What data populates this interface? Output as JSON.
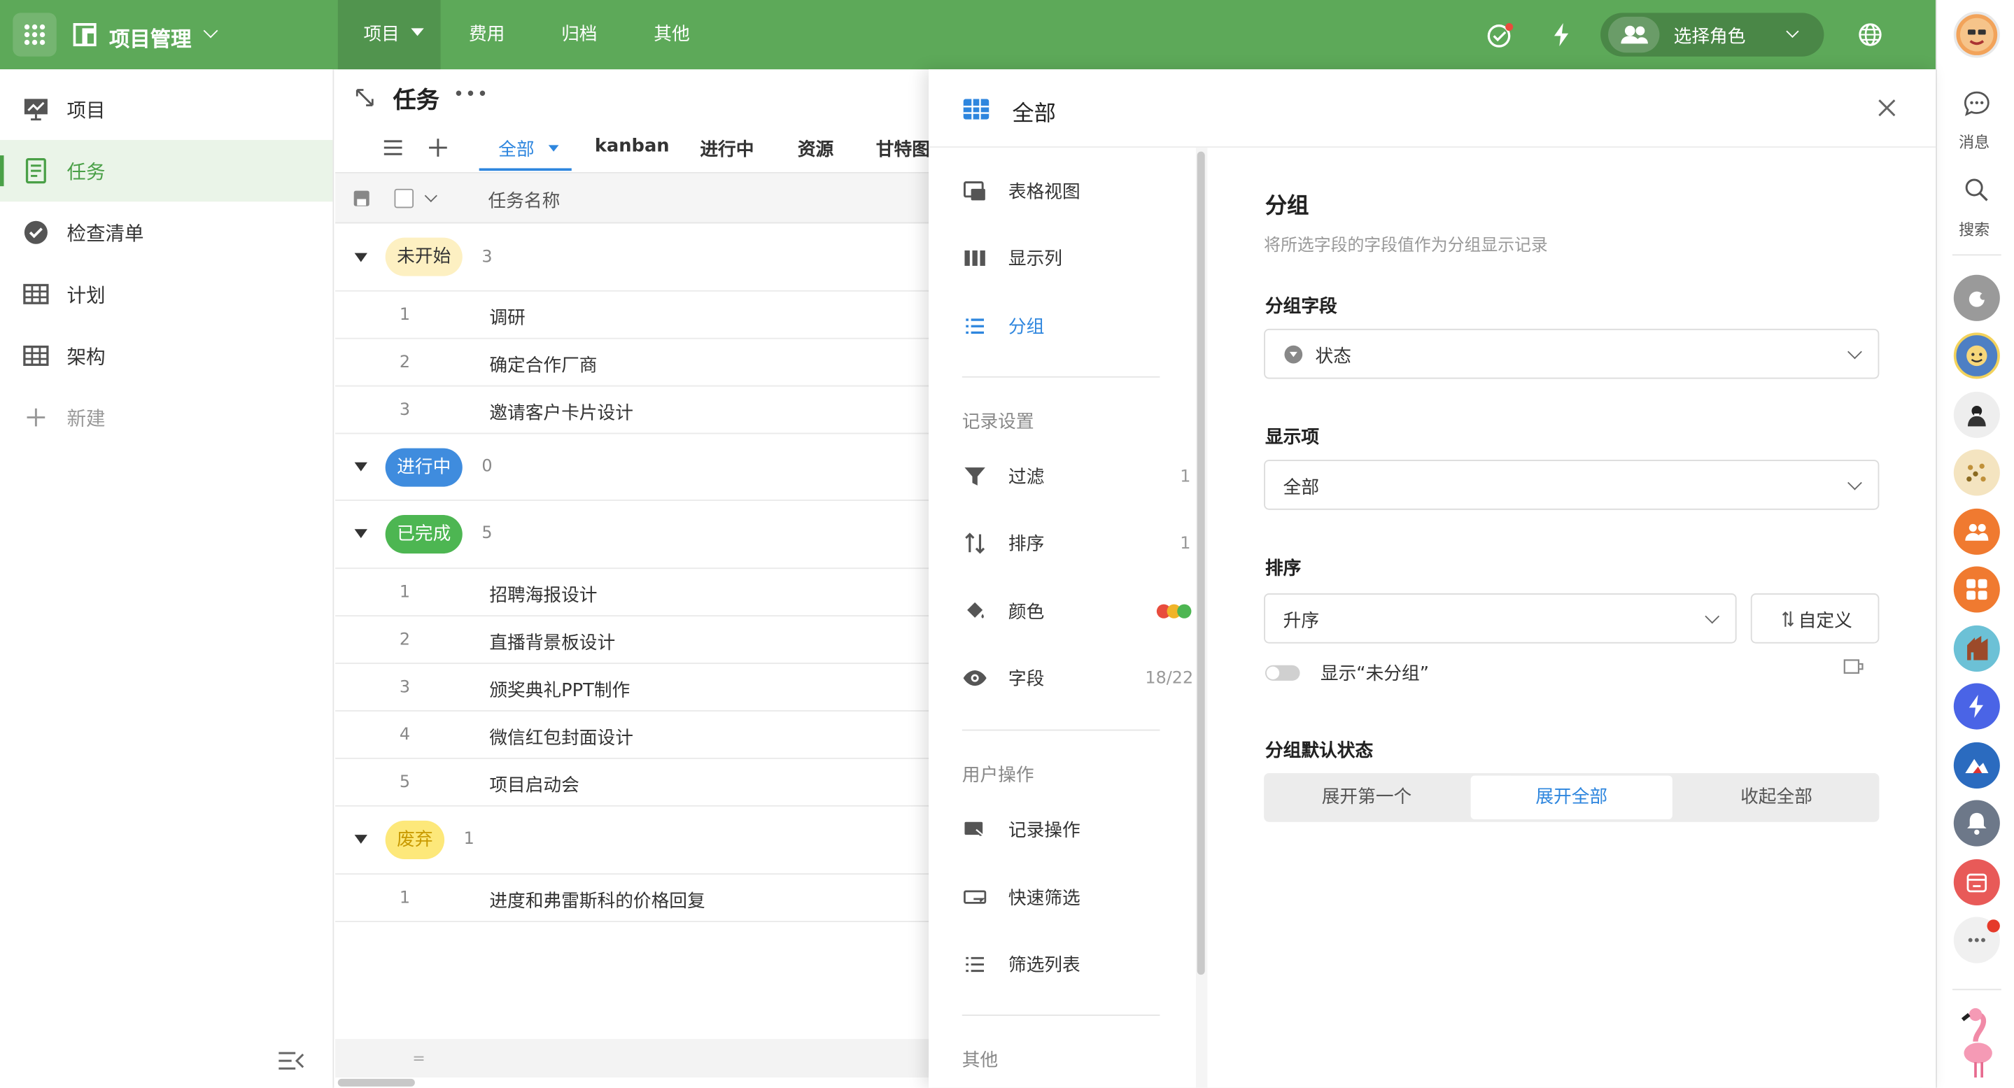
{
  "topbar": {
    "app_title": "项目管理",
    "nav": [
      "项目",
      "费用",
      "归档",
      "其他"
    ],
    "role_label": "选择角色",
    "accent": "#5da959"
  },
  "rail": {
    "messages": "消息",
    "search": "搜索"
  },
  "sidebar": {
    "items": [
      {
        "label": "项目",
        "icon": "presentation-chart-icon"
      },
      {
        "label": "任务",
        "icon": "task-list-icon"
      },
      {
        "label": "检查清单",
        "icon": "check-badge-icon"
      },
      {
        "label": "计划",
        "icon": "table-grid-icon"
      },
      {
        "label": "架构",
        "icon": "table-grid-icon"
      }
    ],
    "new_label": "新建"
  },
  "main": {
    "title": "任务",
    "view_tabs": [
      "全部",
      "kanban",
      "进行中",
      "资源",
      "甘特图"
    ],
    "column_header": "任务名称",
    "groups": [
      {
        "label": "未开始",
        "count": "3",
        "bg": "#fdf0c2",
        "fg": "#333",
        "rows": [
          {
            "n": "1",
            "t": "调研"
          },
          {
            "n": "2",
            "t": "确定合作厂商"
          },
          {
            "n": "3",
            "t": "邀请客户卡片设计"
          }
        ]
      },
      {
        "label": "进行中",
        "count": "0",
        "bg": "#3f8cde",
        "fg": "#fff",
        "rows": []
      },
      {
        "label": "已完成",
        "count": "5",
        "bg": "#4db652",
        "fg": "#fff",
        "rows": [
          {
            "n": "1",
            "t": "招聘海报设计"
          },
          {
            "n": "2",
            "t": "直播背景板设计"
          },
          {
            "n": "3",
            "t": "颁奖典礼PPT制作"
          },
          {
            "n": "4",
            "t": "微信红包封面设计"
          },
          {
            "n": "5",
            "t": "项目启动会"
          }
        ]
      },
      {
        "label": "废弃",
        "count": "1",
        "bg": "#fde87a",
        "fg": "#c99a00",
        "rows": [
          {
            "n": "1",
            "t": "进度和弗雷斯科的价格回复"
          }
        ]
      }
    ],
    "footer_eq": "="
  },
  "panel": {
    "title": "全部",
    "menu_top": [
      "表格视图",
      "显示列",
      "分组"
    ],
    "record_section": "记录设置",
    "record_items": [
      {
        "label": "过滤",
        "value": "1"
      },
      {
        "label": "排序",
        "value": "1"
      },
      {
        "label": "颜色",
        "value": ""
      },
      {
        "label": "字段",
        "value": "18/22"
      }
    ],
    "user_section": "用户操作",
    "user_items": [
      "记录操作",
      "快速筛选",
      "筛选列表"
    ],
    "other_section": "其他",
    "settings": {
      "heading": "分组",
      "desc": "将所选字段的字段值作为分组显示记录",
      "group_field_label": "分组字段",
      "group_field_value": "状态",
      "display_label": "显示项",
      "display_value": "全部",
      "sort_label": "排序",
      "sort_value": "升序",
      "custom_label": "自定义",
      "toggle_label": "显示“未分组”",
      "default_state_label": "分组默认状态",
      "segments": [
        "展开第一个",
        "展开全部",
        "收起全部"
      ],
      "active_segment": "展开全部"
    }
  }
}
